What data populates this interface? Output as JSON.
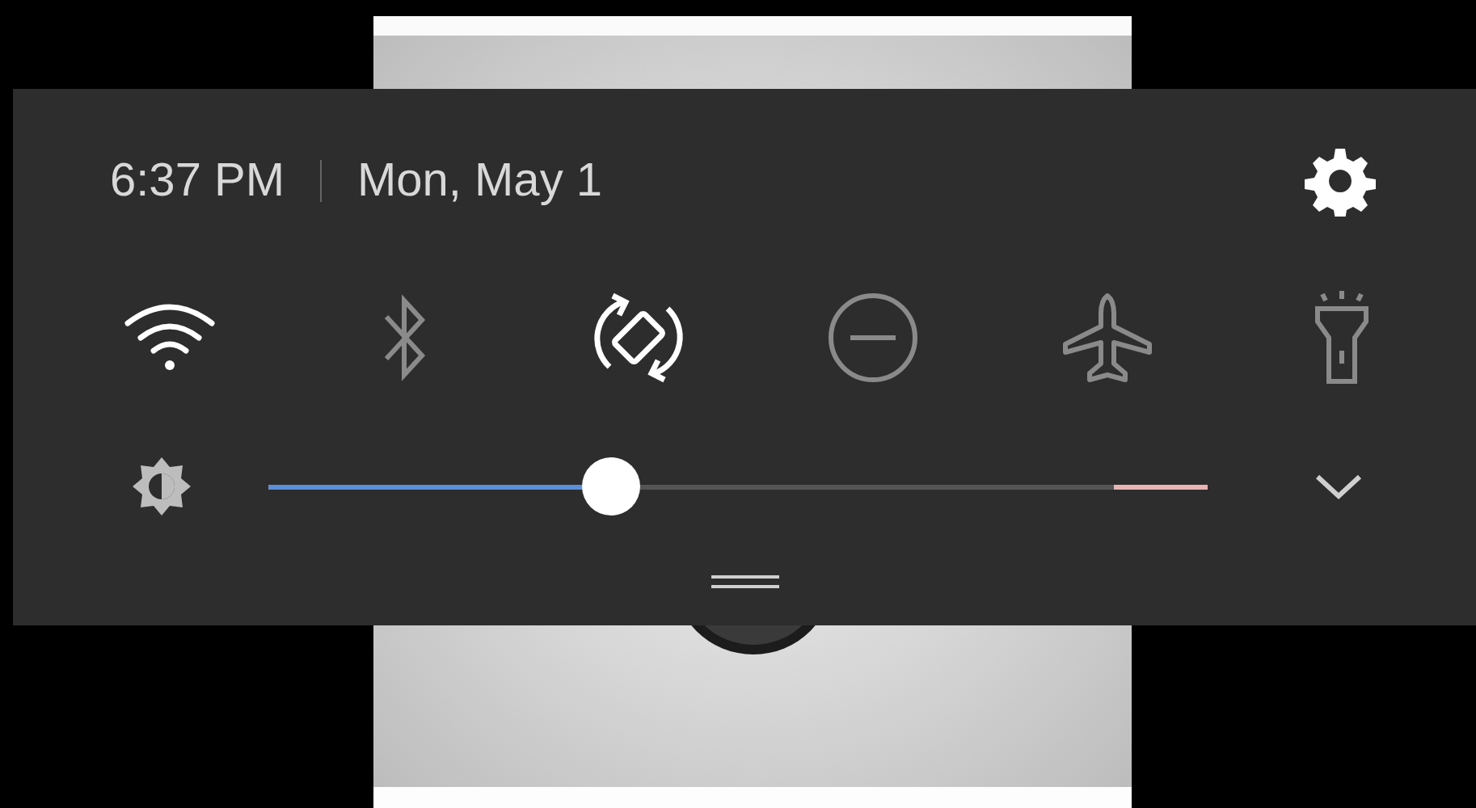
{
  "header": {
    "time": "6:37 PM",
    "date": "Mon, May 1"
  },
  "tiles": [
    {
      "kind": "wifi",
      "on": true
    },
    {
      "kind": "bluetooth",
      "on": false
    },
    {
      "kind": "rotate",
      "on": true
    },
    {
      "kind": "dnd",
      "on": false
    },
    {
      "kind": "airplane",
      "on": false
    },
    {
      "kind": "flashlight",
      "on": false
    }
  ],
  "brightness": {
    "level": 0.365
  }
}
